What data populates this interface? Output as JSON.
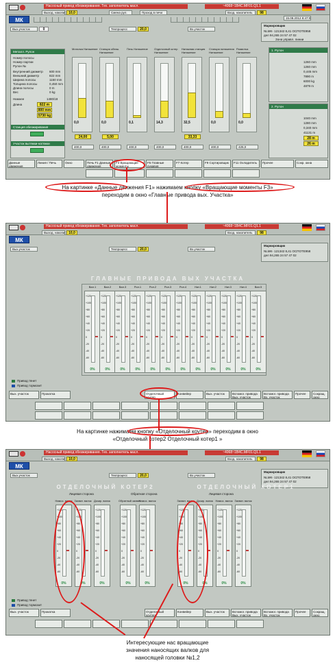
{
  "captions": {
    "first": [
      "На картинке «Данные движения F1» нажимаем кнопку «Вращающие моменты F3»",
      "переходим в окно «Главные привода вых. Участка»"
    ],
    "second": [
      "На картинке нажимаем кнопку «Отделочный коутер» переходим в окно",
      "«Отделочный котер2 Отделочный котер1 »"
    ],
    "third": [
      "Интересующие нас вращающие",
      "значения наносящих валков для",
      "наносящей головки №1,2"
    ]
  },
  "common": {
    "logo": "МК",
    "alarm_text": "Насосный привод обезжиривания. Тех. заполнитель масл.",
    "status_text": "~4068~1B4C.MF01.Q1.1",
    "date": "15.08.2012 8:47:02",
    "marking_label": "Маркировщик",
    "marking_text": [
      "NLMK- 121342 8,41 ОСПОТЕ958",
      "дел 94,265 24 57 47 02"
    ],
    "zone_label": "Зона управл. линии",
    "out_store_label": "Выход. накопитель",
    "out_store_value": "10,0",
    "out_store_unit": "%",
    "in_store_label": "Вход. накопитель",
    "in_store_value": "98",
    "in_store_unit": "%",
    "sec_out": "Вых.участок",
    "sec_tech": "Техпроцесс",
    "tech_value": "20,0",
    "sec_in": "Вх.участок",
    "unit": "м/мин",
    "roll_change": "Смена рул.",
    "roll_speed_label": "Проход в печи",
    "nav_center": "Верх. вакуум"
  },
  "screen1": {
    "rulon": "Металл. Рулон",
    "rulon_fields": [
      "Номер полосы",
      "Номер партии",
      "Рулон №",
      "Внутренний диаметр",
      "Внешний диаметр",
      "Ширина полосы",
      "Толщина полосы",
      "Длина полосы",
      "Вес"
    ],
    "rulon_values": [
      "600 mm",
      "822 mm",
      "1150 mm",
      "0,450 mm",
      "0 m",
      "0 kg"
    ],
    "kolvo_label": "Нижнее",
    "kolvo_value": "1480/18",
    "dlina_label": "Длина",
    "dlina_values": [
      "822 m",
      "800 mm",
      "5730 kg"
    ],
    "station1": "Станция обезжиривания",
    "station2": "Участок вытяжки-натяжки",
    "gauges": [
      {
        "title": "Моталка Натяжение",
        "value": "0,0",
        "fill": 0.35,
        "nm": "24,00",
        "s": "400,0"
      },
      {
        "title": "Станция обезж. Натяжение",
        "value": "0,0",
        "fill": 0.3,
        "nm": "5,00",
        "s": "400,0"
      },
      {
        "title": "Печь Натяжение",
        "value": "0,1",
        "fill": 0.05,
        "nm": "",
        "s": "400,0"
      },
      {
        "title": "Отделочный котер Натяжение",
        "value": "14,3",
        "fill": 0.3,
        "nm": "",
        "s": "400,0"
      },
      {
        "title": "Натяжная станция Натяжение",
        "value": "32,5",
        "fill": 0.45,
        "nm": "33,33",
        "s": "400,0"
      },
      {
        "title": "Станция натяжения Натяжение",
        "value": "0,0",
        "fill": 0.12,
        "nm": "",
        "s": "400,0"
      },
      {
        "title": "Размотка Натяжение",
        "value": "0,0",
        "fill": 0.08,
        "nm": "",
        "s": "425,0"
      }
    ],
    "rulon2": "1. Рулон",
    "rulon3": "2. Рулон",
    "rulon2_values": [
      "1260 mm",
      "1260 mm",
      "0,445 mm",
      "7890 m",
      "6000 kg",
      "4879 m"
    ],
    "rulon3_values": [
      "1040 mm",
      "1280 mm",
      "0,340 mm",
      "41131 m",
      "28 m",
      "26 m"
    ],
    "buttons": [
      "Данные движения",
      "Линия / Печь",
      "Окно",
      "Печь F1 Данные движения",
      "F3 Вращающие моменты",
      "F5 Главные рукавов",
      "F7 Котер",
      "F9 Сортировщик",
      "F11 Охладитель",
      "Прочее",
      "Сокр. окна"
    ]
  },
  "screen2": {
    "title": "ГЛАВНЫЕ ПРИВОДА ВЫХ УЧАСТКА",
    "groups": [
      "Моталка",
      "Станция натяжения",
      "Натяжная станция",
      "Участок отделки",
      "Натяжной ролик",
      "Печь вытяжки"
    ],
    "drives": [
      "Вал.1",
      "Вал.2",
      "Вал.3",
      "Рол.1",
      "Рол.2",
      "Рол.3",
      "Рол.4",
      "Нат.1",
      "Нат.2",
      "Нат.3",
      "Нат.4",
      "Вал.5"
    ],
    "pct": "0%",
    "ticks": [
      "+120",
      "+100",
      "+80",
      "+60",
      "+40",
      "+20",
      "0",
      "-20",
      "-40",
      "-60"
    ],
    "legend": [
      "Привод тянет",
      "Привод тормозит"
    ],
    "buttons": [
      "Вых. участок",
      "Прокатка",
      "Отделочный коутер",
      "Конвейер",
      "Вых. участок",
      "Вспомог. привода Вых. участок",
      "Вспомог. привода Вх. участок",
      "Прочее",
      "Сокращ. окно"
    ]
  },
  "screen3": {
    "title_left": "ОТДЕЛОЧНЫЙ КОТЕР2",
    "title_right": "ОТДЕЛОЧНЫЙ КОТЕР1",
    "col_head": [
      "Намос. валок",
      "Захват. валок",
      "Дозир. валок",
      "Обратный захват",
      "Намос. валок",
      "Захват. валок",
      "Дозир. валок",
      "Намос. валок",
      "Захват. валок"
    ],
    "sub_left": [
      "Лицевая сторона",
      "Обратная сторона"
    ],
    "sub_right": [
      "Лицевая сторона",
      "Обратная сторона"
    ],
    "pct": "0%",
    "legend": [
      "Привод тянет",
      "Привод тормозит"
    ]
  }
}
